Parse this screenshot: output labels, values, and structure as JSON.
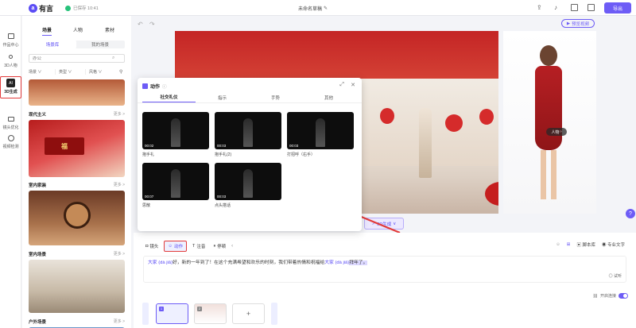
{
  "app": {
    "logo_text": "有言",
    "save_status": "已保存 10:41",
    "doc_title": "未命名草稿",
    "export_label": "导出"
  },
  "rail": [
    {
      "label": "作品中心",
      "icon": "folder-icon"
    },
    {
      "label": "3D人物",
      "icon": "person-icon"
    },
    {
      "label": "3D生成",
      "icon": "ai-icon"
    },
    {
      "label": "镜头优化",
      "icon": "camera-icon"
    },
    {
      "label": "视频检测",
      "icon": "scan-icon"
    }
  ],
  "scene_panel": {
    "tabs": [
      "场景",
      "人物",
      "素材"
    ],
    "subtabs": [
      "场景库",
      "我的场景"
    ],
    "search_placeholder": "办公",
    "filters": [
      "场景",
      "类型",
      "风格"
    ],
    "categories": [
      {
        "label": "现代主义",
        "more": "更多 >"
      },
      {
        "label": "室内家装",
        "more": "更多 >"
      },
      {
        "label": "室内场景",
        "more": "更多 >"
      },
      {
        "label": "户外场景",
        "more": "更多 >"
      }
    ]
  },
  "stage": {
    "preview_button": "预览视频",
    "person_tag": "人物",
    "gen_button": "3D生成"
  },
  "dialog": {
    "title": "动作",
    "tabs": [
      "社交礼仪",
      "指示",
      "手势",
      "其他"
    ],
    "clips": [
      {
        "duration": "00:02",
        "label": "抱手礼"
      },
      {
        "duration": "00:03",
        "label": "抱手礼(2)"
      },
      {
        "duration": "00:03",
        "label": "打招呼（右手）"
      },
      {
        "duration": "00:07",
        "label": "思散"
      },
      {
        "duration": "00:03",
        "label": "点头搭话"
      }
    ]
  },
  "editor": {
    "toolbar": [
      "镜头",
      "动作",
      "注音",
      "停顿"
    ],
    "right_tools": [
      "脚本库",
      "专业文字"
    ],
    "script_text": "好，新的一年到了！在这个充满希望和欢乐的时刻，我们带着热情和祝福给",
    "script_lead": "大家 (dà jiā)",
    "script_mid": "大家 (dà jiā)",
    "script_tail": "拜年了。",
    "generate_label": "试听",
    "toggle_label": "开启连接",
    "add_label": "+"
  }
}
